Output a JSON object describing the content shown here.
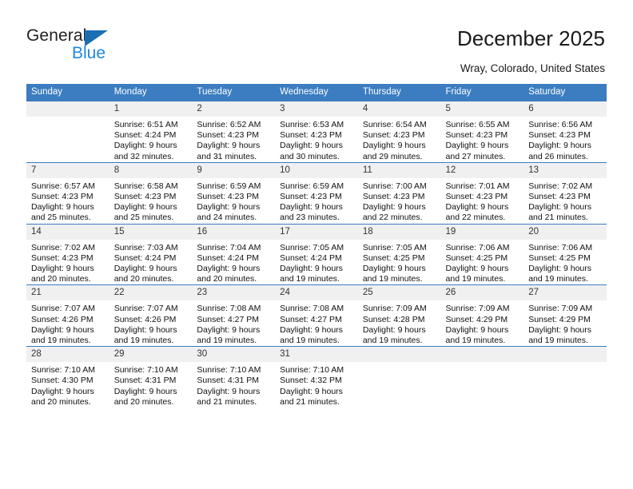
{
  "brand": {
    "name_top": "General",
    "name_bottom": "Blue",
    "accent_color": "#1a6eb5",
    "blue_text_color": "#1f88e0"
  },
  "header": {
    "title": "December 2025",
    "subtitle": "Wray, Colorado, United States"
  },
  "calendar": {
    "header_bg": "#3b7dc0",
    "daynum_bg": "#f0f0f0",
    "weekday_headers": [
      "Sunday",
      "Monday",
      "Tuesday",
      "Wednesday",
      "Thursday",
      "Friday",
      "Saturday"
    ],
    "weeks": [
      [
        {
          "day": "",
          "blank": true,
          "sunrise": "",
          "sunset": "",
          "daylight_line1": "",
          "daylight_line2": ""
        },
        {
          "day": "1",
          "sunrise": "Sunrise: 6:51 AM",
          "sunset": "Sunset: 4:24 PM",
          "daylight_line1": "Daylight: 9 hours",
          "daylight_line2": "and 32 minutes."
        },
        {
          "day": "2",
          "sunrise": "Sunrise: 6:52 AM",
          "sunset": "Sunset: 4:23 PM",
          "daylight_line1": "Daylight: 9 hours",
          "daylight_line2": "and 31 minutes."
        },
        {
          "day": "3",
          "sunrise": "Sunrise: 6:53 AM",
          "sunset": "Sunset: 4:23 PM",
          "daylight_line1": "Daylight: 9 hours",
          "daylight_line2": "and 30 minutes."
        },
        {
          "day": "4",
          "sunrise": "Sunrise: 6:54 AM",
          "sunset": "Sunset: 4:23 PM",
          "daylight_line1": "Daylight: 9 hours",
          "daylight_line2": "and 29 minutes."
        },
        {
          "day": "5",
          "sunrise": "Sunrise: 6:55 AM",
          "sunset": "Sunset: 4:23 PM",
          "daylight_line1": "Daylight: 9 hours",
          "daylight_line2": "and 27 minutes."
        },
        {
          "day": "6",
          "sunrise": "Sunrise: 6:56 AM",
          "sunset": "Sunset: 4:23 PM",
          "daylight_line1": "Daylight: 9 hours",
          "daylight_line2": "and 26 minutes."
        }
      ],
      [
        {
          "day": "7",
          "sunrise": "Sunrise: 6:57 AM",
          "sunset": "Sunset: 4:23 PM",
          "daylight_line1": "Daylight: 9 hours",
          "daylight_line2": "and 25 minutes."
        },
        {
          "day": "8",
          "sunrise": "Sunrise: 6:58 AM",
          "sunset": "Sunset: 4:23 PM",
          "daylight_line1": "Daylight: 9 hours",
          "daylight_line2": "and 25 minutes."
        },
        {
          "day": "9",
          "sunrise": "Sunrise: 6:59 AM",
          "sunset": "Sunset: 4:23 PM",
          "daylight_line1": "Daylight: 9 hours",
          "daylight_line2": "and 24 minutes."
        },
        {
          "day": "10",
          "sunrise": "Sunrise: 6:59 AM",
          "sunset": "Sunset: 4:23 PM",
          "daylight_line1": "Daylight: 9 hours",
          "daylight_line2": "and 23 minutes."
        },
        {
          "day": "11",
          "sunrise": "Sunrise: 7:00 AM",
          "sunset": "Sunset: 4:23 PM",
          "daylight_line1": "Daylight: 9 hours",
          "daylight_line2": "and 22 minutes."
        },
        {
          "day": "12",
          "sunrise": "Sunrise: 7:01 AM",
          "sunset": "Sunset: 4:23 PM",
          "daylight_line1": "Daylight: 9 hours",
          "daylight_line2": "and 22 minutes."
        },
        {
          "day": "13",
          "sunrise": "Sunrise: 7:02 AM",
          "sunset": "Sunset: 4:23 PM",
          "daylight_line1": "Daylight: 9 hours",
          "daylight_line2": "and 21 minutes."
        }
      ],
      [
        {
          "day": "14",
          "sunrise": "Sunrise: 7:02 AM",
          "sunset": "Sunset: 4:23 PM",
          "daylight_line1": "Daylight: 9 hours",
          "daylight_line2": "and 20 minutes."
        },
        {
          "day": "15",
          "sunrise": "Sunrise: 7:03 AM",
          "sunset": "Sunset: 4:24 PM",
          "daylight_line1": "Daylight: 9 hours",
          "daylight_line2": "and 20 minutes."
        },
        {
          "day": "16",
          "sunrise": "Sunrise: 7:04 AM",
          "sunset": "Sunset: 4:24 PM",
          "daylight_line1": "Daylight: 9 hours",
          "daylight_line2": "and 20 minutes."
        },
        {
          "day": "17",
          "sunrise": "Sunrise: 7:05 AM",
          "sunset": "Sunset: 4:24 PM",
          "daylight_line1": "Daylight: 9 hours",
          "daylight_line2": "and 19 minutes."
        },
        {
          "day": "18",
          "sunrise": "Sunrise: 7:05 AM",
          "sunset": "Sunset: 4:25 PM",
          "daylight_line1": "Daylight: 9 hours",
          "daylight_line2": "and 19 minutes."
        },
        {
          "day": "19",
          "sunrise": "Sunrise: 7:06 AM",
          "sunset": "Sunset: 4:25 PM",
          "daylight_line1": "Daylight: 9 hours",
          "daylight_line2": "and 19 minutes."
        },
        {
          "day": "20",
          "sunrise": "Sunrise: 7:06 AM",
          "sunset": "Sunset: 4:25 PM",
          "daylight_line1": "Daylight: 9 hours",
          "daylight_line2": "and 19 minutes."
        }
      ],
      [
        {
          "day": "21",
          "sunrise": "Sunrise: 7:07 AM",
          "sunset": "Sunset: 4:26 PM",
          "daylight_line1": "Daylight: 9 hours",
          "daylight_line2": "and 19 minutes."
        },
        {
          "day": "22",
          "sunrise": "Sunrise: 7:07 AM",
          "sunset": "Sunset: 4:26 PM",
          "daylight_line1": "Daylight: 9 hours",
          "daylight_line2": "and 19 minutes."
        },
        {
          "day": "23",
          "sunrise": "Sunrise: 7:08 AM",
          "sunset": "Sunset: 4:27 PM",
          "daylight_line1": "Daylight: 9 hours",
          "daylight_line2": "and 19 minutes."
        },
        {
          "day": "24",
          "sunrise": "Sunrise: 7:08 AM",
          "sunset": "Sunset: 4:27 PM",
          "daylight_line1": "Daylight: 9 hours",
          "daylight_line2": "and 19 minutes."
        },
        {
          "day": "25",
          "sunrise": "Sunrise: 7:09 AM",
          "sunset": "Sunset: 4:28 PM",
          "daylight_line1": "Daylight: 9 hours",
          "daylight_line2": "and 19 minutes."
        },
        {
          "day": "26",
          "sunrise": "Sunrise: 7:09 AM",
          "sunset": "Sunset: 4:29 PM",
          "daylight_line1": "Daylight: 9 hours",
          "daylight_line2": "and 19 minutes."
        },
        {
          "day": "27",
          "sunrise": "Sunrise: 7:09 AM",
          "sunset": "Sunset: 4:29 PM",
          "daylight_line1": "Daylight: 9 hours",
          "daylight_line2": "and 19 minutes."
        }
      ],
      [
        {
          "day": "28",
          "sunrise": "Sunrise: 7:10 AM",
          "sunset": "Sunset: 4:30 PM",
          "daylight_line1": "Daylight: 9 hours",
          "daylight_line2": "and 20 minutes."
        },
        {
          "day": "29",
          "sunrise": "Sunrise: 7:10 AM",
          "sunset": "Sunset: 4:31 PM",
          "daylight_line1": "Daylight: 9 hours",
          "daylight_line2": "and 20 minutes."
        },
        {
          "day": "30",
          "sunrise": "Sunrise: 7:10 AM",
          "sunset": "Sunset: 4:31 PM",
          "daylight_line1": "Daylight: 9 hours",
          "daylight_line2": "and 21 minutes."
        },
        {
          "day": "31",
          "sunrise": "Sunrise: 7:10 AM",
          "sunset": "Sunset: 4:32 PM",
          "daylight_line1": "Daylight: 9 hours",
          "daylight_line2": "and 21 minutes."
        },
        {
          "day": "",
          "blank": true,
          "sunrise": "",
          "sunset": "",
          "daylight_line1": "",
          "daylight_line2": ""
        },
        {
          "day": "",
          "blank": true,
          "sunrise": "",
          "sunset": "",
          "daylight_line1": "",
          "daylight_line2": ""
        },
        {
          "day": "",
          "blank": true,
          "sunrise": "",
          "sunset": "",
          "daylight_line1": "",
          "daylight_line2": ""
        }
      ]
    ]
  }
}
